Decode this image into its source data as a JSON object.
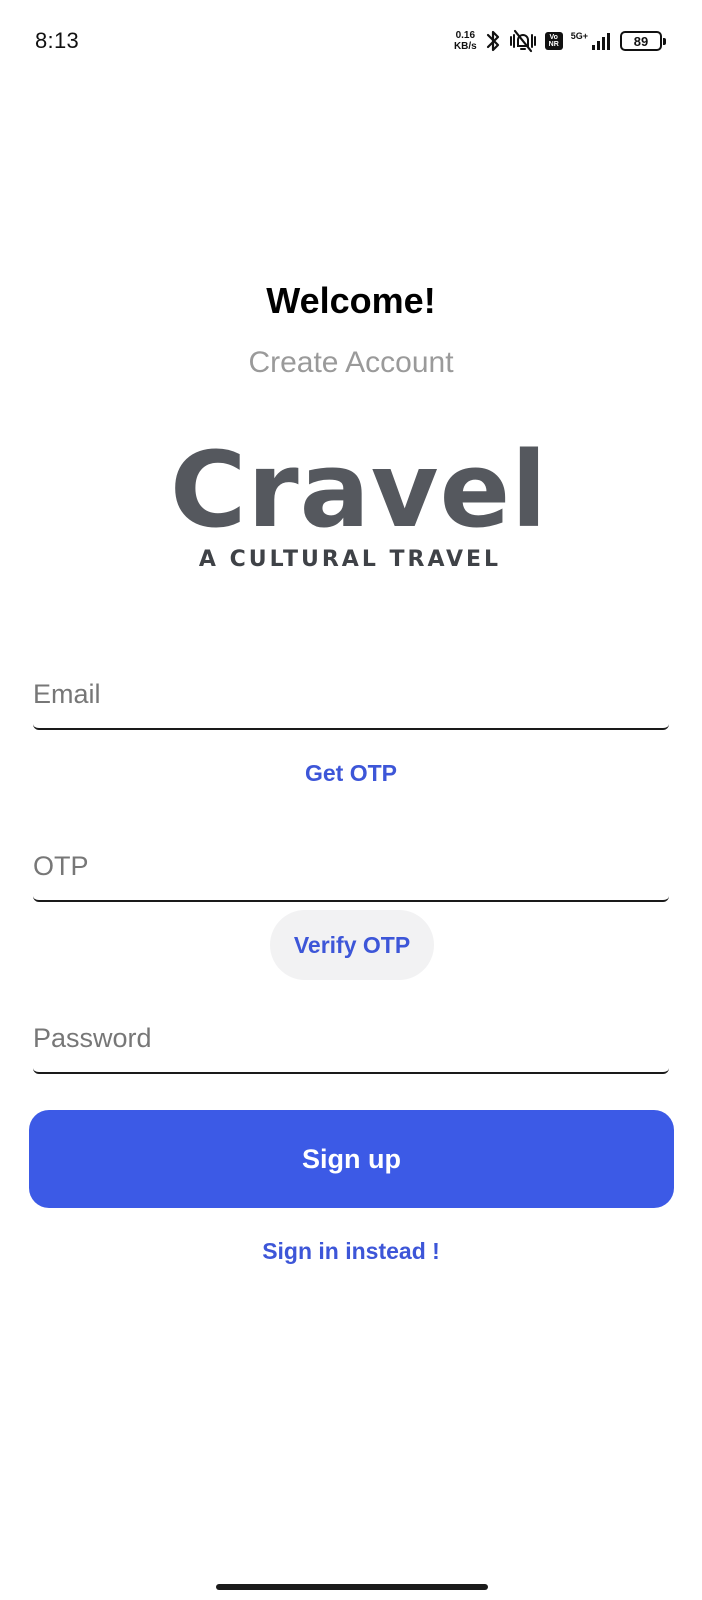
{
  "status_bar": {
    "time": "8:13",
    "net_speed_value": "0.16",
    "net_speed_unit": "KB/s",
    "volte_top": "Vo",
    "volte_bottom": "NR",
    "network_type": "5G+",
    "battery_level": "89",
    "icons": [
      "bluetooth-icon",
      "vibrate-mute-icon",
      "volte-icon",
      "signal-icon",
      "battery-icon"
    ]
  },
  "header": {
    "title": "Welcome!",
    "subtitle": "Create Account"
  },
  "logo": {
    "wordmark": "Cravel",
    "tagline": "A CULTURAL TRAVEL",
    "color": "#55585e"
  },
  "form": {
    "email": {
      "value": "",
      "placeholder": "Email"
    },
    "get_otp_label": "Get OTP",
    "otp": {
      "value": "",
      "placeholder": "OTP"
    },
    "verify_otp_label": "Verify OTP",
    "password": {
      "value": "",
      "placeholder": "Password"
    },
    "signup_label": "Sign up",
    "signin_link_label": "Sign in instead !"
  },
  "colors": {
    "primary": "#3c5ae6",
    "link": "#3d56d8",
    "subtitle": "#9a9a9a"
  }
}
